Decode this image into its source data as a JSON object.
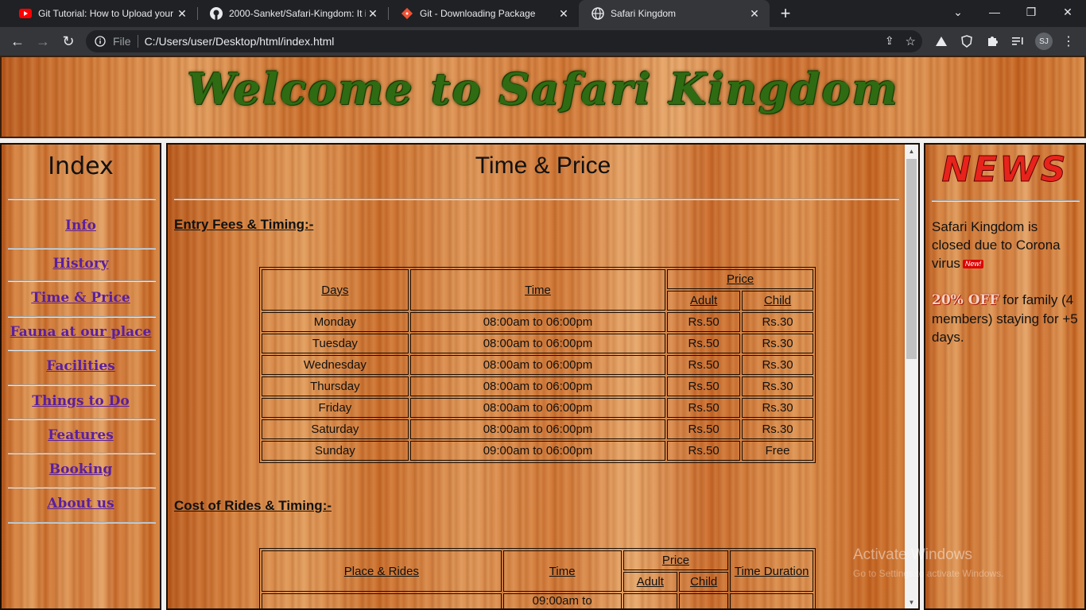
{
  "browser": {
    "tabs": [
      {
        "title": "Git Tutorial: How to Upload your",
        "icon": "youtube-icon"
      },
      {
        "title": "2000-Sanket/Safari-Kingdom: It i",
        "icon": "github-icon"
      },
      {
        "title": "Git - Downloading Package",
        "icon": "git-icon"
      },
      {
        "title": "Safari Kingdom",
        "icon": "globe-icon"
      }
    ],
    "address": {
      "scheme_label": "File",
      "url": "C:/Users/user/Desktop/html/index.html"
    },
    "profile_initials": "SJ"
  },
  "header": {
    "title": "Welcome to Safari Kingdom"
  },
  "index": {
    "heading": "Index",
    "links": [
      "Info",
      "History",
      "Time & Price",
      "Fauna at our place",
      "Facilities",
      "Things to Do",
      "Features",
      "Booking",
      "About us"
    ]
  },
  "main": {
    "heading": "Time & Price",
    "entry_heading": "Entry Fees & Timing:-",
    "entry_table": {
      "headers": {
        "days": "Days",
        "time": "Time",
        "price": "Price",
        "adult": "Adult",
        "child": "Child"
      },
      "rows": [
        {
          "day": "Monday",
          "time": "08:00am to 06:00pm",
          "adult": "Rs.50",
          "child": "Rs.30"
        },
        {
          "day": "Tuesday",
          "time": "08:00am to 06:00pm",
          "adult": "Rs.50",
          "child": "Rs.30"
        },
        {
          "day": "Wednesday",
          "time": "08:00am to 06:00pm",
          "adult": "Rs.50",
          "child": "Rs.30"
        },
        {
          "day": "Thursday",
          "time": "08:00am to 06:00pm",
          "adult": "Rs.50",
          "child": "Rs.30"
        },
        {
          "day": "Friday",
          "time": "08:00am to 06:00pm",
          "adult": "Rs.50",
          "child": "Rs.30"
        },
        {
          "day": "Saturday",
          "time": "08:00am to 06:00pm",
          "adult": "Rs.50",
          "child": "Rs.30"
        },
        {
          "day": "Sunday",
          "time": "09:00am to 06:00pm",
          "adult": "Rs.50",
          "child": "Free"
        }
      ]
    },
    "rides_heading": "Cost of Rides & Timing:-",
    "rides_table": {
      "headers": {
        "place": "Place & Rides",
        "time": "Time",
        "price": "Price",
        "adult": "Adult",
        "child": "Child",
        "duration": "Time Duration"
      },
      "first_row_time": "09:00am to"
    }
  },
  "news": {
    "heading": "NEWS",
    "item1": "Safari Kingdom is closed due to Corona virus",
    "badge": "New!",
    "offer": "20% OFF",
    "item2": "for family (4 members) staying for +5 days."
  },
  "watermark": {
    "title": "Activate Windows",
    "subtitle": "Go to Settings to activate Windows."
  }
}
